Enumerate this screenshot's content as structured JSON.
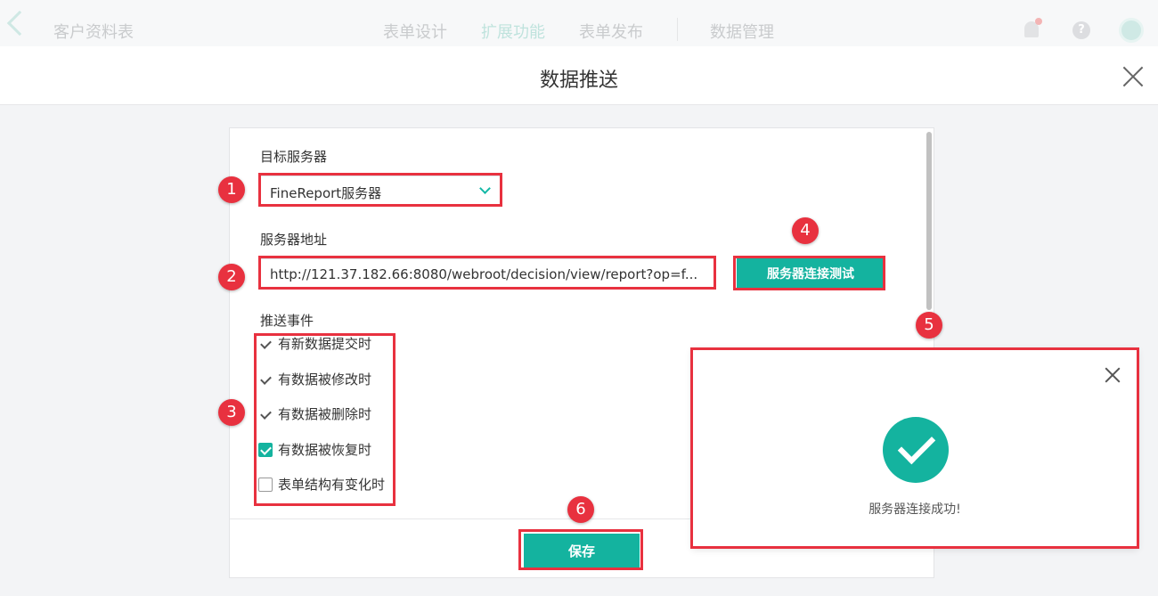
{
  "appbar": {
    "title": "客户资料表",
    "nav": [
      {
        "label": "表单设计",
        "active": false
      },
      {
        "label": "扩展功能",
        "active": true
      },
      {
        "label": "表单发布",
        "active": false
      },
      {
        "label": "数据管理",
        "active": false
      }
    ],
    "help_glyph": "?"
  },
  "modal": {
    "title": "数据推送"
  },
  "form": {
    "target_server_label": "目标服务器",
    "target_server_value": "FineReport服务器",
    "server_address_label": "服务器地址",
    "server_address_value": "http://121.37.182.66:8080/webroot/decision/view/report?op=f...",
    "test_button": "服务器连接测试",
    "events_label": "推送事件",
    "events": [
      {
        "label": "有新数据提交时",
        "state": "checked"
      },
      {
        "label": "有数据被修改时",
        "state": "checked"
      },
      {
        "label": "有数据被删除时",
        "state": "checked"
      },
      {
        "label": "有数据被恢复时",
        "state": "checked-filled"
      },
      {
        "label": "表单结构有变化时",
        "state": "unchecked"
      }
    ],
    "save_button": "保存"
  },
  "popup": {
    "message": "服务器连接成功!"
  },
  "callouts": [
    "1",
    "2",
    "3",
    "4",
    "5",
    "6"
  ],
  "colors": {
    "accent": "#14b39f",
    "highlight": "#e8313f"
  }
}
